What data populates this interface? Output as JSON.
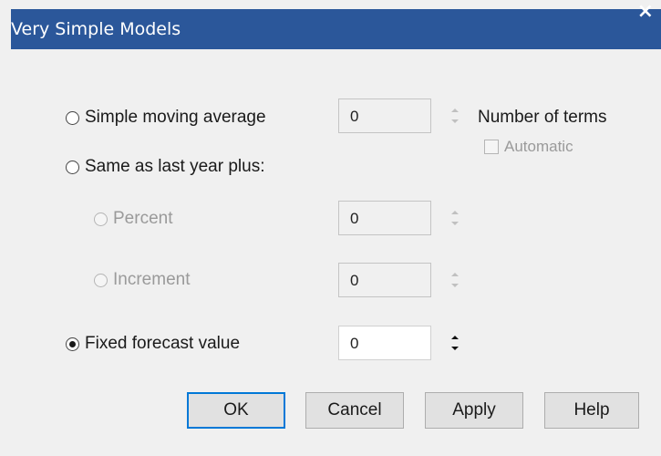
{
  "dialog": {
    "title": "Very Simple Models",
    "close_glyph": "×"
  },
  "options": {
    "sma_label": "Simple moving average",
    "sma_value": "0",
    "number_of_terms_label": "Number of terms",
    "automatic_label": "Automatic",
    "same_last_year_label": "Same as last year plus:",
    "percent_label": "Percent",
    "percent_value": "0",
    "increment_label": "Increment",
    "increment_value": "0",
    "fixed_label": "Fixed forecast value",
    "fixed_value": "0",
    "selected": "Fixed forecast value"
  },
  "buttons": {
    "ok": "OK",
    "cancel": "Cancel",
    "apply": "Apply",
    "help": "Help"
  },
  "colors": {
    "titlebar": "#2b579a",
    "default_button_border": "#0078d7"
  }
}
